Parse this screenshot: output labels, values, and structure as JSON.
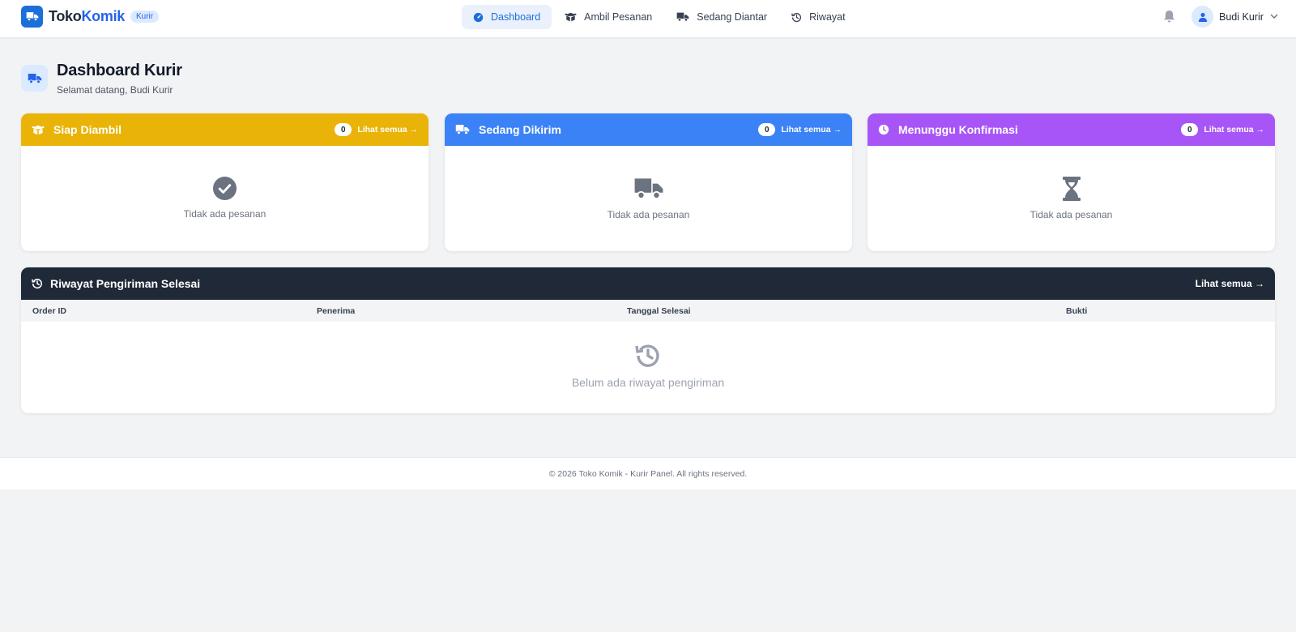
{
  "brand": {
    "name_part1": "Toko",
    "name_part2": "Komik",
    "badge": "Kurir",
    "logo_icon": "truck-icon"
  },
  "nav": {
    "items": [
      {
        "label": "Dashboard",
        "icon": "gauge-icon",
        "active": true
      },
      {
        "label": "Ambil Pesanan",
        "icon": "box-open-icon",
        "active": false
      },
      {
        "label": "Sedang Diantar",
        "icon": "truck-icon",
        "active": false
      },
      {
        "label": "Riwayat",
        "icon": "history-icon",
        "active": false
      }
    ]
  },
  "user": {
    "name": "Budi Kurir",
    "avatar_icon": "user-icon"
  },
  "page": {
    "title": "Dashboard Kurir",
    "subtitle": "Selamat datang, Budi Kurir"
  },
  "cards": [
    {
      "title": "Siap Diambil",
      "count": "0",
      "see_all": "Lihat semua →",
      "empty_text": "Tidak ada pesanan",
      "color": "#eab308",
      "icon": "box-open-icon",
      "empty_icon": "check-circle-icon"
    },
    {
      "title": "Sedang Dikirim",
      "count": "0",
      "see_all": "Lihat semua →",
      "empty_text": "Tidak ada pesanan",
      "color": "#3b82f6",
      "icon": "truck-icon",
      "empty_icon": "truck-icon"
    },
    {
      "title": "Menunggu Konfirmasi",
      "count": "0",
      "see_all": "Lihat semua →",
      "empty_text": "Tidak ada pesanan",
      "color": "#a855f7",
      "icon": "clock-icon",
      "empty_icon": "hourglass-icon"
    }
  ],
  "history": {
    "title": "Riwayat Pengiriman Selesai",
    "see_all": "Lihat semua →",
    "columns": [
      "Order ID",
      "Penerima",
      "Tanggal Selesai",
      "Bukti"
    ],
    "empty_text": "Belum ada riwayat pengiriman",
    "header_color": "#1f2937"
  },
  "footer": {
    "text": "© 2026 Toko Komik - Kurir Panel. All rights reserved."
  }
}
